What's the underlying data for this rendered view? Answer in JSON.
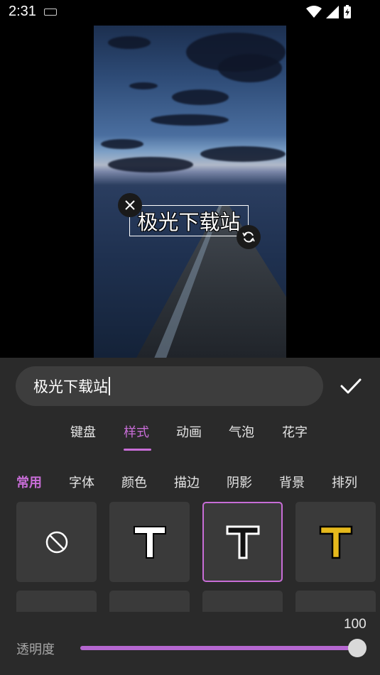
{
  "status_bar": {
    "time": "2:31"
  },
  "preview": {
    "overlay_text": "极光下载站"
  },
  "editor": {
    "input_value": "极光下载站",
    "tabs": [
      {
        "label": "键盘"
      },
      {
        "label": "样式"
      },
      {
        "label": "动画"
      },
      {
        "label": "气泡"
      },
      {
        "label": "花字"
      }
    ],
    "active_tab": "样式",
    "subtabs": [
      {
        "label": "常用"
      },
      {
        "label": "字体"
      },
      {
        "label": "颜色"
      },
      {
        "label": "描边"
      },
      {
        "label": "阴影"
      },
      {
        "label": "背景"
      },
      {
        "label": "排列"
      }
    ],
    "active_subtab": "常用",
    "style_presets": [
      {
        "name": "none-icon",
        "glyph": ""
      },
      {
        "name": "white-outline",
        "glyph": "T"
      },
      {
        "name": "white-outline-thin",
        "glyph": "T",
        "selected": true
      },
      {
        "name": "yellow-outline",
        "glyph": "T"
      }
    ],
    "opacity": {
      "label": "透明度",
      "value": "100",
      "fraction": 1.0
    }
  },
  "colors": {
    "accent": "#c86dd7",
    "panel": "#2a2a2a",
    "cell": "#3a3a3a",
    "yellow": "#e6b91c"
  }
}
